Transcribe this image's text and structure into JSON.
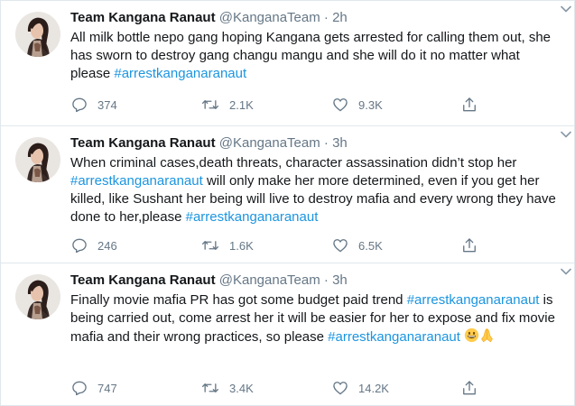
{
  "colors": {
    "link": "#1b95e0",
    "muted": "#657786",
    "text": "#14171a",
    "divider": "#e1e8ed"
  },
  "tweets": [
    {
      "name": "Team Kangana Ranaut",
      "handle": "@KanganaTeam",
      "separator": "·",
      "time": "2h",
      "text_before": "All milk bottle nepo gang hoping Kangana gets arrested for calling them out, she has sworn to destroy gang changu mangu and she will do it no matter what  please ",
      "hashtag_1": "#arrestkanganaranaut",
      "replies": "374",
      "retweets": "2.1K",
      "likes": "9.3K"
    },
    {
      "name": "Team Kangana Ranaut",
      "handle": "@KanganaTeam",
      "separator": "·",
      "time": "3h",
      "text_before": "When criminal cases,death threats, character assassination didn’t stop her ",
      "hashtag_1": "#arrestkanganaranaut",
      "text_middle": " will only make her more determined, even if you get her killed, like Sushant her being will live to destroy mafia and every wrong they have done to her,please ",
      "hashtag_2": "#arrestkanganaranaut",
      "replies": "246",
      "retweets": "1.6K",
      "likes": "6.5K"
    },
    {
      "name": "Team Kangana Ranaut",
      "handle": "@KanganaTeam",
      "separator": "·",
      "time": "3h",
      "text_before": "Finally movie mafia PR has got some budget paid trend ",
      "hashtag_1": "#arrestkanganaranaut",
      "text_middle": " is being carried out, come arrest her it will be easier for her to expose and fix movie mafia and their wrong practices, so please ",
      "hashtag_2": "#arrestkanganaranaut",
      "emojis": [
        "grinning-face-emoji",
        "folded-hands-emoji"
      ],
      "replies": "747",
      "retweets": "3.4K",
      "likes": "14.2K"
    }
  ],
  "icons": {
    "reply": "reply-icon",
    "retweet": "retweet-icon",
    "like": "heart-icon",
    "share": "share-icon",
    "caret": "chevron-down-icon"
  }
}
